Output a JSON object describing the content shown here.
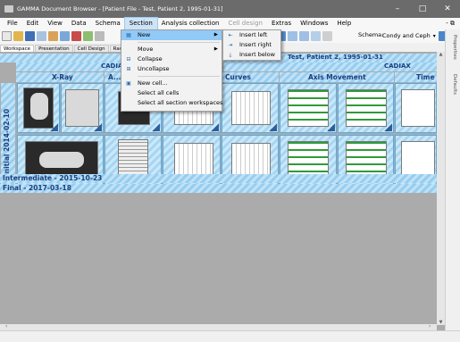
{
  "window": {
    "title": "GAMMA Document Browser - [Patient File - Test, Patient 2, 1995-01-31]",
    "minimize": "–",
    "maximize": "□",
    "close": "✕"
  },
  "menu": {
    "items": [
      "File",
      "Edit",
      "View",
      "Data",
      "Schema",
      "Section",
      "Analysis collection",
      "Cell design",
      "Extras",
      "Windows",
      "Help"
    ],
    "right_controls": "- ⧉"
  },
  "toolbar": {
    "schema_label": "Schema:",
    "schema_value": "Condy and Ceph"
  },
  "tabs": [
    "Workspace",
    "Presentation",
    "Cell Design",
    "Raw D..."
  ],
  "workspace": {
    "patient_header": "Test, Patient 2, 1995-01-31",
    "groups": {
      "cadias": "CADIAS",
      "cadiax": "CADIAX"
    },
    "columns": [
      "X-Ray",
      "A...",
      "Curves",
      "Axis Movement",
      "Time"
    ],
    "sections": {
      "initial": "Initial 2014-02-10",
      "intermediate": "Intermediate - 2015-10-23",
      "final": "Final - 2017-03-18"
    }
  },
  "section_menu": {
    "items": [
      {
        "label": "New",
        "icon": "new-icon",
        "has_submenu": true,
        "highlighted": true
      },
      {
        "separator": true
      },
      {
        "label": "Move",
        "icon": "",
        "has_submenu": true
      },
      {
        "label": "Collapse",
        "icon": "collapse-icon"
      },
      {
        "label": "Uncollapse",
        "icon": "uncollapse-icon"
      },
      {
        "separator": true
      },
      {
        "label": "New cell...",
        "icon": "new-cell-icon"
      },
      {
        "label": "Select all cells",
        "icon": ""
      },
      {
        "label": "Select all section workspaces",
        "icon": ""
      }
    ]
  },
  "new_submenu": {
    "items": [
      {
        "label": "Insert left",
        "icon": "insert-left-icon"
      },
      {
        "label": "Insert right",
        "icon": "insert-right-icon"
      },
      {
        "label": "Insert below",
        "icon": "insert-below-icon"
      }
    ]
  },
  "right_panel": {
    "properties": "Properties",
    "defaults": "Defaults"
  },
  "colors": {
    "titlebar": "#6b6b6b",
    "header_text": "#1c3f80",
    "workspace_bg": "#ababab",
    "menu_highlight": "#91c9f7"
  }
}
